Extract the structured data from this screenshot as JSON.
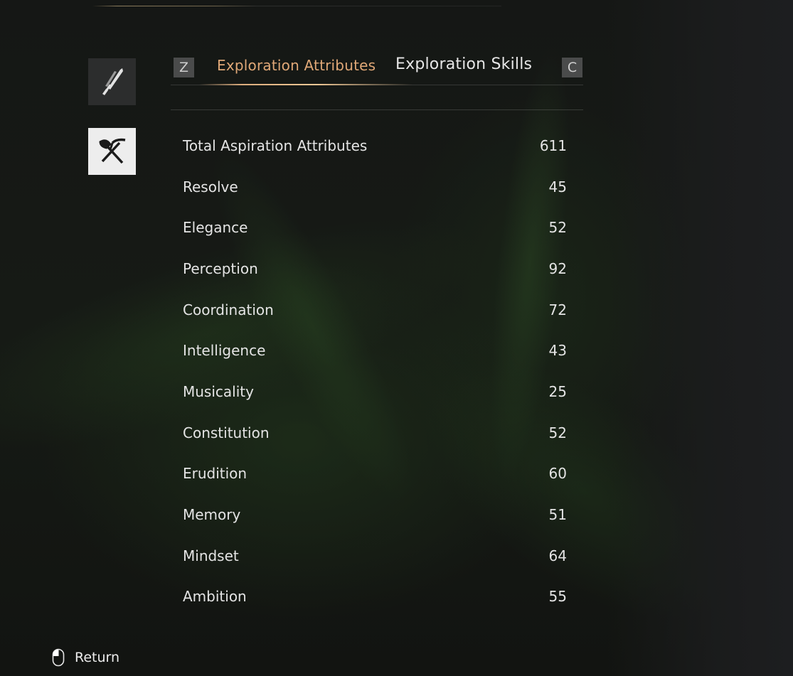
{
  "sidebar": {
    "items": [
      {
        "icon": "sword-icon",
        "active": false
      },
      {
        "icon": "shovel-pickaxe-icon",
        "active": true
      }
    ]
  },
  "tabs": {
    "prev_key": "Z",
    "next_key": "C",
    "items": [
      {
        "label": "Exploration Attributes",
        "active": true
      },
      {
        "label": "Exploration Skills",
        "active": false
      }
    ]
  },
  "attributes": [
    {
      "name": "Total Aspiration Attributes",
      "value": "611"
    },
    {
      "name": "Resolve",
      "value": "45"
    },
    {
      "name": "Elegance",
      "value": "52"
    },
    {
      "name": "Perception",
      "value": "92"
    },
    {
      "name": "Coordination",
      "value": "72"
    },
    {
      "name": "Intelligence",
      "value": "43"
    },
    {
      "name": "Musicality",
      "value": "25"
    },
    {
      "name": "Constitution",
      "value": "52"
    },
    {
      "name": "Erudition",
      "value": "60"
    },
    {
      "name": "Memory",
      "value": "51"
    },
    {
      "name": "Mindset",
      "value": "64"
    },
    {
      "name": "Ambition",
      "value": "55"
    }
  ],
  "footer": {
    "icon": "mouse-icon",
    "label": "Return"
  },
  "colors": {
    "accent": "#e0a877",
    "text": "#e4e4e4",
    "background": "#141614"
  }
}
